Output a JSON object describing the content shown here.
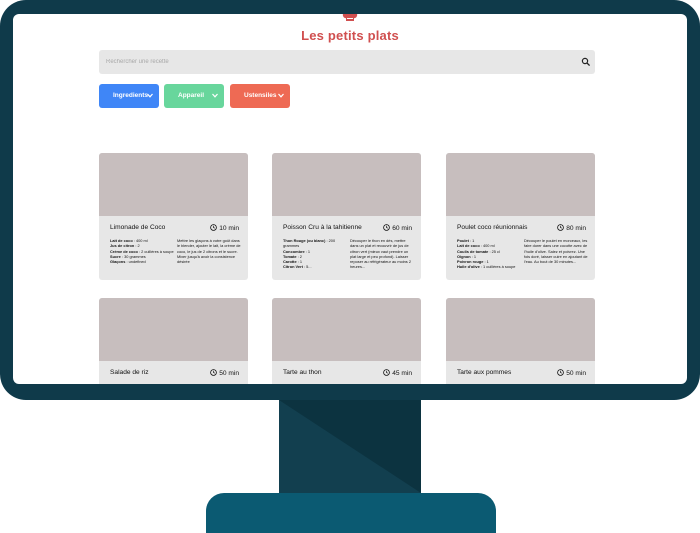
{
  "site": {
    "title": "Les petits plats",
    "logo_icon": "chef-hat-icon"
  },
  "search": {
    "placeholder": "Rechercher une recette"
  },
  "filters": [
    {
      "label": "Ingredients",
      "color": "#3f86f7"
    },
    {
      "label": "Appareil",
      "color": "#68d69c"
    },
    {
      "label": "Ustensiles",
      "color": "#ee6a54"
    }
  ],
  "recipes": [
    {
      "name": "Limonade de Coco",
      "time": "10 min",
      "ingredients": [
        {
          "name": "Lait de coco",
          "qty": ": 400 ml"
        },
        {
          "name": "Jus de citron",
          "qty": ": 2"
        },
        {
          "name": "Crème de coco",
          "qty": ": 2 cuillères à soupe"
        },
        {
          "name": "Sucre",
          "qty": ": 30 grammes"
        },
        {
          "name": "Glaçons",
          "qty": ": undefined"
        }
      ],
      "description": "Mettre les glaçons à votre goût dans le blender, ajouter le lait, la crème de coco, le jus de 2 citrons et le sucre. Mixer jusqu'à avoir la consistence désirée"
    },
    {
      "name": "Poisson Cru à la tahitienne",
      "time": "60 min",
      "ingredients": [
        {
          "name": "Thon Rouge (ou blanc)",
          "qty": ": 200 grammes"
        },
        {
          "name": "Concombre",
          "qty": ": 1"
        },
        {
          "name": "Tomate",
          "qty": ": 2"
        },
        {
          "name": "Carotte",
          "qty": ": 1"
        },
        {
          "name": "Citron Vert",
          "qty": ": 5..."
        }
      ],
      "description": "Découper le thon en dés, mettre dans un plat et recouvrir de jus de citron vert (mieux vaut prendre un plat large et peu profond). Laisser reposer au réfrigérateur au moins 2 heures..."
    },
    {
      "name": "Poulet coco réunionnais",
      "time": "80 min",
      "ingredients": [
        {
          "name": "Poulet",
          "qty": ": 1"
        },
        {
          "name": "Lait de coco",
          "qty": ": 400 ml"
        },
        {
          "name": "Coulis de tomate",
          "qty": ": 25 cl"
        },
        {
          "name": "Oignon",
          "qty": ": 1"
        },
        {
          "name": "Poivron rouge",
          "qty": ": 1"
        },
        {
          "name": "Huile d'olive",
          "qty": ": 1 cuillères à soupe"
        }
      ],
      "description": "Découper le poulet en morceaux, les faire dorer dans une cocotte avec de l'huile d'olive. Salez et poivrez. Une fois doré, laisser cuire en ajoutant de l'eau. Au bout de 30 minutes..."
    },
    {
      "name": "Salade de riz",
      "time": "50 min",
      "ingredients": [],
      "description": ""
    },
    {
      "name": "Tarte au thon",
      "time": "45 min",
      "ingredients": [],
      "description": ""
    },
    {
      "name": "Tarte aux pommes",
      "time": "50 min",
      "ingredients": [],
      "description": ""
    }
  ],
  "colors": {
    "frame": "#0f3a4a",
    "accent": "#d04f4f",
    "card_image": "#c7bebe",
    "card_bg": "#e7e7e7"
  }
}
